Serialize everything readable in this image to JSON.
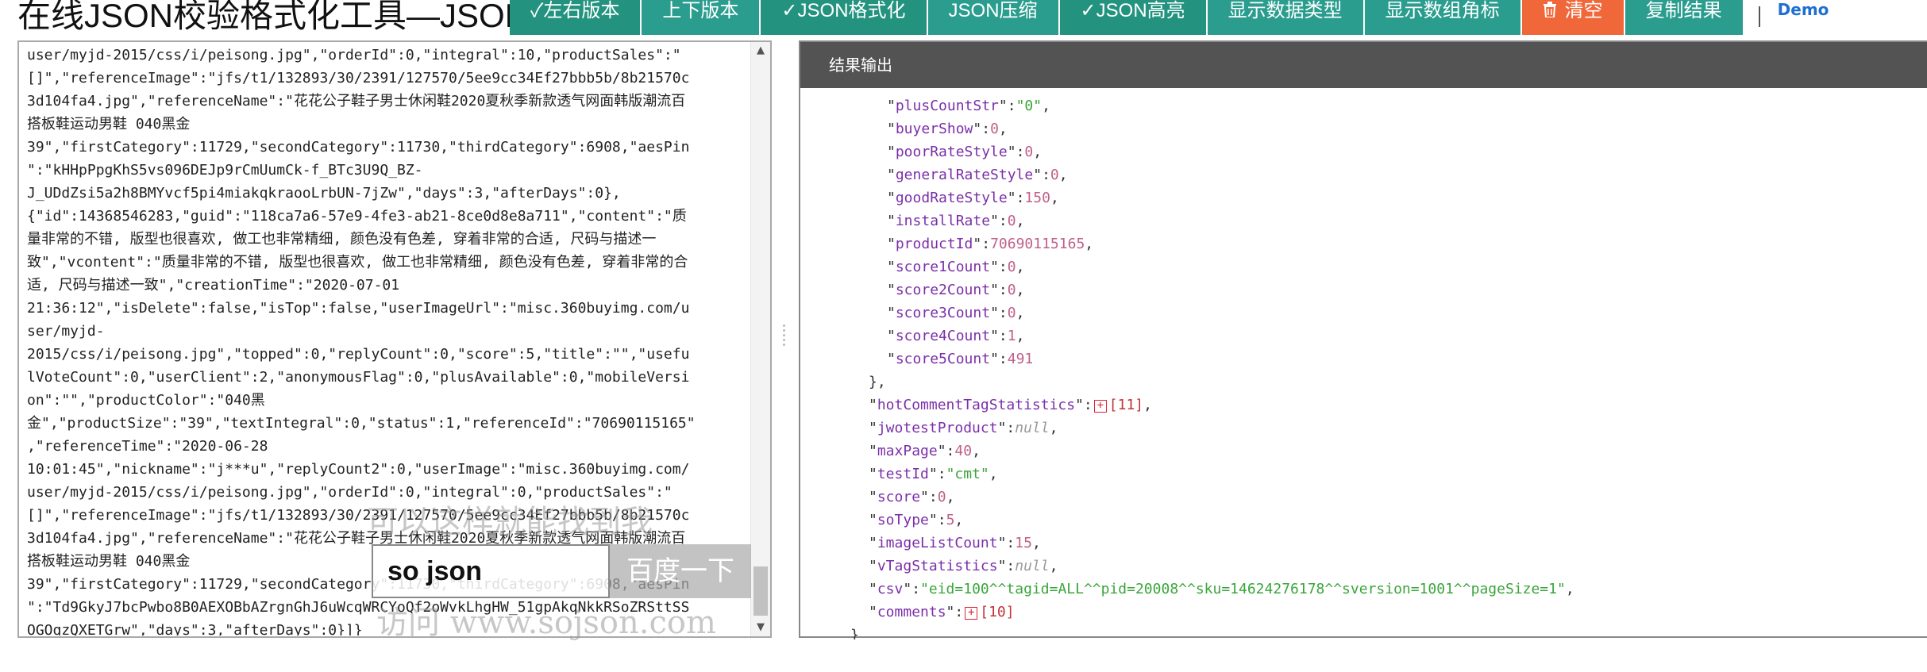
{
  "page": {
    "title": "在线JSON校验格式化工具—JSON"
  },
  "toolbar": {
    "buttons": [
      "✓左右版本",
      "上下版本",
      "✓JSON格式化",
      "JSON压缩",
      "✓JSON高亮",
      "显示数据类型",
      "显示数组角标",
      "清空",
      "复制结果"
    ],
    "link": "Demo"
  },
  "icons": {
    "clear": "trash-icon",
    "expand": "plus-square-icon"
  },
  "colors": {
    "toolbar": "#2a9d8f",
    "danger": "#f0673a",
    "header": "#535353",
    "key": "#7b2fa8",
    "number": "#c0608a",
    "string": "#3aa53a",
    "null": "#999999"
  },
  "input": {
    "lines": [
      "user/myjd-2015/css/i/peisong.jpg\",\"orderId\":0,\"integral\":10,\"productSales\":\"",
      "[]\",\"referenceImage\":\"jfs/t1/132893/30/2391/127570/5ee9cc34Ef27bbb5b/8b21570c",
      "3d104fa4.jpg\",\"referenceName\":\"花花公子鞋子男士休闲鞋2020夏秋季新款透气网面韩版潮流百",
      "搭板鞋运动男鞋 040黑金",
      "39\",\"firstCategory\":11729,\"secondCategory\":11730,\"thirdCategory\":6908,\"aesPin",
      "\":\"kHHpPpgKhS5vs096DEJp9rCmUumCk-f_BTc3U9Q_BZ-",
      "J_UDdZsi5a2h8BMYvcf5pi4miakqkraooLrbUN-7jZw\",\"days\":3,\"afterDays\":0},",
      "{\"id\":14368546283,\"guid\":\"118ca7a6-57e9-4fe3-ab21-8ce0d8e8a711\",\"content\":\"质",
      "量非常的不错, 版型也很喜欢, 做工也非常精细, 颜色没有色差, 穿着非常的合适, 尺码与描述一",
      "致\",\"vcontent\":\"质量非常的不错, 版型也很喜欢, 做工也非常精细, 颜色没有色差, 穿着非常的合",
      "适, 尺码与描述一致\",\"creationTime\":\"2020-07-01",
      "21:36:12\",\"isDelete\":false,\"isTop\":false,\"userImageUrl\":\"misc.360buyimg.com/u",
      "ser/myjd-",
      "2015/css/i/peisong.jpg\",\"topped\":0,\"replyCount\":0,\"score\":5,\"title\":\"\",\"usefu",
      "lVoteCount\":0,\"userClient\":2,\"anonymousFlag\":0,\"plusAvailable\":0,\"mobileVersi",
      "on\":\"\",\"productColor\":\"040黑",
      "金\",\"productSize\":\"39\",\"textIntegral\":0,\"status\":1,\"referenceId\":\"70690115165\"",
      ",\"referenceTime\":\"2020-06-28",
      "10:01:45\",\"nickname\":\"j***u\",\"replyCount2\":0,\"userImage\":\"misc.360buyimg.com/",
      "user/myjd-2015/css/i/peisong.jpg\",\"orderId\":0,\"integral\":0,\"productSales\":\"",
      "[]\",\"referenceImage\":\"jfs/t1/132893/30/2391/127570/5ee9cc34Ef27bbb5b/8b21570c",
      "3d104fa4.jpg\",\"referenceName\":\"花花公子鞋子男士休闲鞋2020夏秋季新款透气网面韩版潮流百",
      "搭板鞋运动男鞋 040黑金",
      "39\",\"firstCategory\":11729,\"secondCategory\":11730,\"thirdCategory\":6908,\"aesPin",
      "\":\"Td9GkyJ7bcPwbo8B0AEXOBbAZrgnGhJ6uWcqWRCYoQf2oWvkLhgHW_51gpAkqNkkRSoZRSttSS",
      "OGOqzQXETGrw\",\"days\":3,\"afterDays\":0}]}"
    ]
  },
  "overlay": {
    "watermark_1": "可以这样就能找到我",
    "watermark_2": "访问 www.sojson.com",
    "search_brand": "so json",
    "search_button": "百度一下"
  },
  "result": {
    "header": "结果输出",
    "rows": [
      {
        "indent": 3,
        "key": "plusCountStr",
        "value": "\"0\"",
        "type": "string",
        "comma": true
      },
      {
        "indent": 3,
        "key": "buyerShow",
        "value": "0",
        "type": "number",
        "comma": true
      },
      {
        "indent": 3,
        "key": "poorRateStyle",
        "value": "0",
        "type": "number",
        "comma": true
      },
      {
        "indent": 3,
        "key": "generalRateStyle",
        "value": "0",
        "type": "number",
        "comma": true
      },
      {
        "indent": 3,
        "key": "goodRateStyle",
        "value": "150",
        "type": "number",
        "comma": true
      },
      {
        "indent": 3,
        "key": "installRate",
        "value": "0",
        "type": "number",
        "comma": true
      },
      {
        "indent": 3,
        "key": "productId",
        "value": "70690115165",
        "type": "number",
        "comma": true
      },
      {
        "indent": 3,
        "key": "score1Count",
        "value": "0",
        "type": "number",
        "comma": true
      },
      {
        "indent": 3,
        "key": "score2Count",
        "value": "0",
        "type": "number",
        "comma": true
      },
      {
        "indent": 3,
        "key": "score3Count",
        "value": "0",
        "type": "number",
        "comma": true
      },
      {
        "indent": 3,
        "key": "score4Count",
        "value": "1",
        "type": "number",
        "comma": true
      },
      {
        "indent": 3,
        "key": "score5Count",
        "value": "491",
        "type": "number",
        "comma": false
      },
      {
        "indent": 2,
        "text": "},"
      },
      {
        "indent": 2,
        "key": "hotCommentTagStatistics",
        "value": "[11]",
        "type": "collapsed",
        "comma": true
      },
      {
        "indent": 2,
        "key": "jwotestProduct",
        "value": "null",
        "type": "null",
        "comma": true
      },
      {
        "indent": 2,
        "key": "maxPage",
        "value": "40",
        "type": "number",
        "comma": true
      },
      {
        "indent": 2,
        "key": "testId",
        "value": "\"cmt\"",
        "type": "string",
        "comma": true
      },
      {
        "indent": 2,
        "key": "score",
        "value": "0",
        "type": "number",
        "comma": true
      },
      {
        "indent": 2,
        "key": "soType",
        "value": "5",
        "type": "number",
        "comma": true
      },
      {
        "indent": 2,
        "key": "imageListCount",
        "value": "15",
        "type": "number",
        "comma": true
      },
      {
        "indent": 2,
        "key": "vTagStatistics",
        "value": "null",
        "type": "null",
        "comma": true
      },
      {
        "indent": 2,
        "key": "csv",
        "value": "\"eid=100^^tagid=ALL^^pid=20008^^sku=14624276178^^sversion=1001^^pageSize=1\"",
        "type": "string",
        "comma": true
      },
      {
        "indent": 2,
        "key": "comments",
        "value": "[10]",
        "type": "collapsed",
        "comma": false
      },
      {
        "indent": 1,
        "text": "}"
      }
    ]
  }
}
